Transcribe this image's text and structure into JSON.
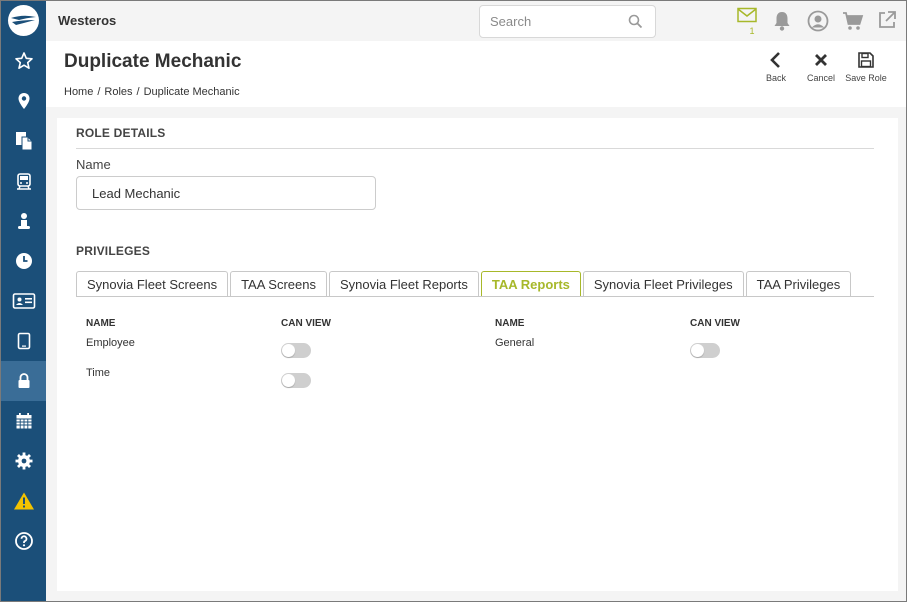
{
  "app": {
    "org_name": "Westeros"
  },
  "search": {
    "placeholder": "Search"
  },
  "topbar": {
    "mail_count": "1"
  },
  "sidebar": {
    "items": [
      {
        "icon": "star-icon"
      },
      {
        "icon": "map-pin-icon"
      },
      {
        "icon": "documents-icon"
      },
      {
        "icon": "bus-icon"
      },
      {
        "icon": "person-icon"
      },
      {
        "icon": "clock-icon"
      },
      {
        "icon": "id-card-icon"
      },
      {
        "icon": "tablet-icon"
      },
      {
        "icon": "lock-icon",
        "active": true
      },
      {
        "icon": "calendar-icon"
      },
      {
        "icon": "gear-icon"
      },
      {
        "icon": "warning-icon"
      },
      {
        "icon": "help-icon"
      }
    ]
  },
  "header": {
    "title": "Duplicate Mechanic",
    "breadcrumb": [
      "Home",
      "Roles",
      "Duplicate Mechanic"
    ],
    "separator": "/",
    "actions": {
      "back": "Back",
      "cancel": "Cancel",
      "save": "Save Role"
    }
  },
  "role_details": {
    "title": "ROLE DETAILS",
    "name_label": "Name",
    "name_value": "Lead Mechanic"
  },
  "privileges": {
    "title": "PRIVILEGES",
    "tabs": [
      "Synovia Fleet Screens",
      "TAA Screens",
      "Synovia Fleet Reports",
      "TAA Reports",
      "Synovia Fleet Privileges",
      "TAA Privileges"
    ],
    "active_tab": "TAA Reports",
    "columns": {
      "name": "NAME",
      "can_view": "CAN VIEW"
    },
    "left_rows": [
      {
        "name": "Employee",
        "can_view": false
      },
      {
        "name": "Time",
        "can_view": false
      }
    ],
    "right_rows": [
      {
        "name": "General",
        "can_view": false
      }
    ]
  },
  "colors": {
    "sidebar": "#1b4f79",
    "accent": "#a7b82a",
    "warning": "#f2c200"
  }
}
